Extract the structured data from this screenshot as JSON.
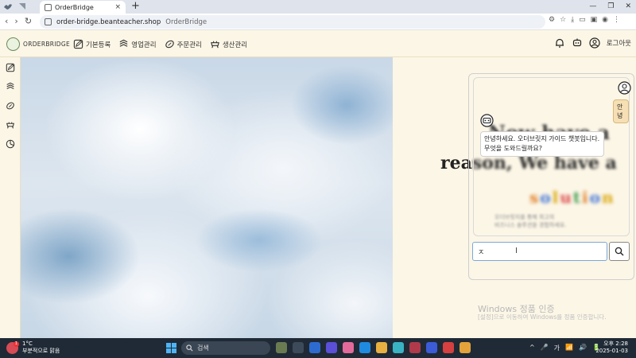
{
  "browser": {
    "tab_title": "OrderBridge",
    "tab_close": "×",
    "new_tab": "+",
    "url_host": "order-bridge.beanteacher.shop",
    "url_title": "OrderBridge",
    "window_controls": [
      "—",
      "❐",
      "✕"
    ]
  },
  "header": {
    "logo_text": "ORDERBRIDGE",
    "nav": [
      {
        "label": "기본등록",
        "icon": "edit-icon"
      },
      {
        "label": "영업관리",
        "icon": "sales-icon"
      },
      {
        "label": "주문관리",
        "icon": "order-icon"
      },
      {
        "label": "생산관리",
        "icon": "production-icon"
      }
    ],
    "logout_label": "로그아웃"
  },
  "sidebar": {
    "items": [
      "edit-icon",
      "sales-icon",
      "order-icon",
      "production-icon",
      "report-icon"
    ]
  },
  "hero": {
    "line1_blur": "Now have a",
    "line2_clear": "rea",
    "line2_blur": "son, We have a",
    "solution_letters": [
      "s",
      "o",
      "l",
      "u",
      "t",
      "i",
      "o",
      "n"
    ],
    "sub_line1": "오더브릿지를 통해 최고의",
    "sub_line2": "비즈니스 솔루션을 경험하세요."
  },
  "chat": {
    "user_message": "안녕",
    "bot_message": "안녕하세요. 오더브릿지 가이드 챗봇입니다. 무엇을 도와드릴까요?",
    "input_value": "ㅈ"
  },
  "watermark": {
    "title": "Windows 정품 인증",
    "subtitle": "[설정]으로 이동하여 Windows를 정품 인증합니다."
  },
  "taskbar": {
    "weather_temp": "1°C",
    "weather_desc": "부분적으로 맑음",
    "weather_badge": "1",
    "search_label": "검색",
    "tray": [
      "^",
      "🎤",
      "가",
      "📶",
      "🔊",
      "🔋"
    ],
    "time_label": "오후 2:28",
    "date_label": "2025-01-03"
  }
}
